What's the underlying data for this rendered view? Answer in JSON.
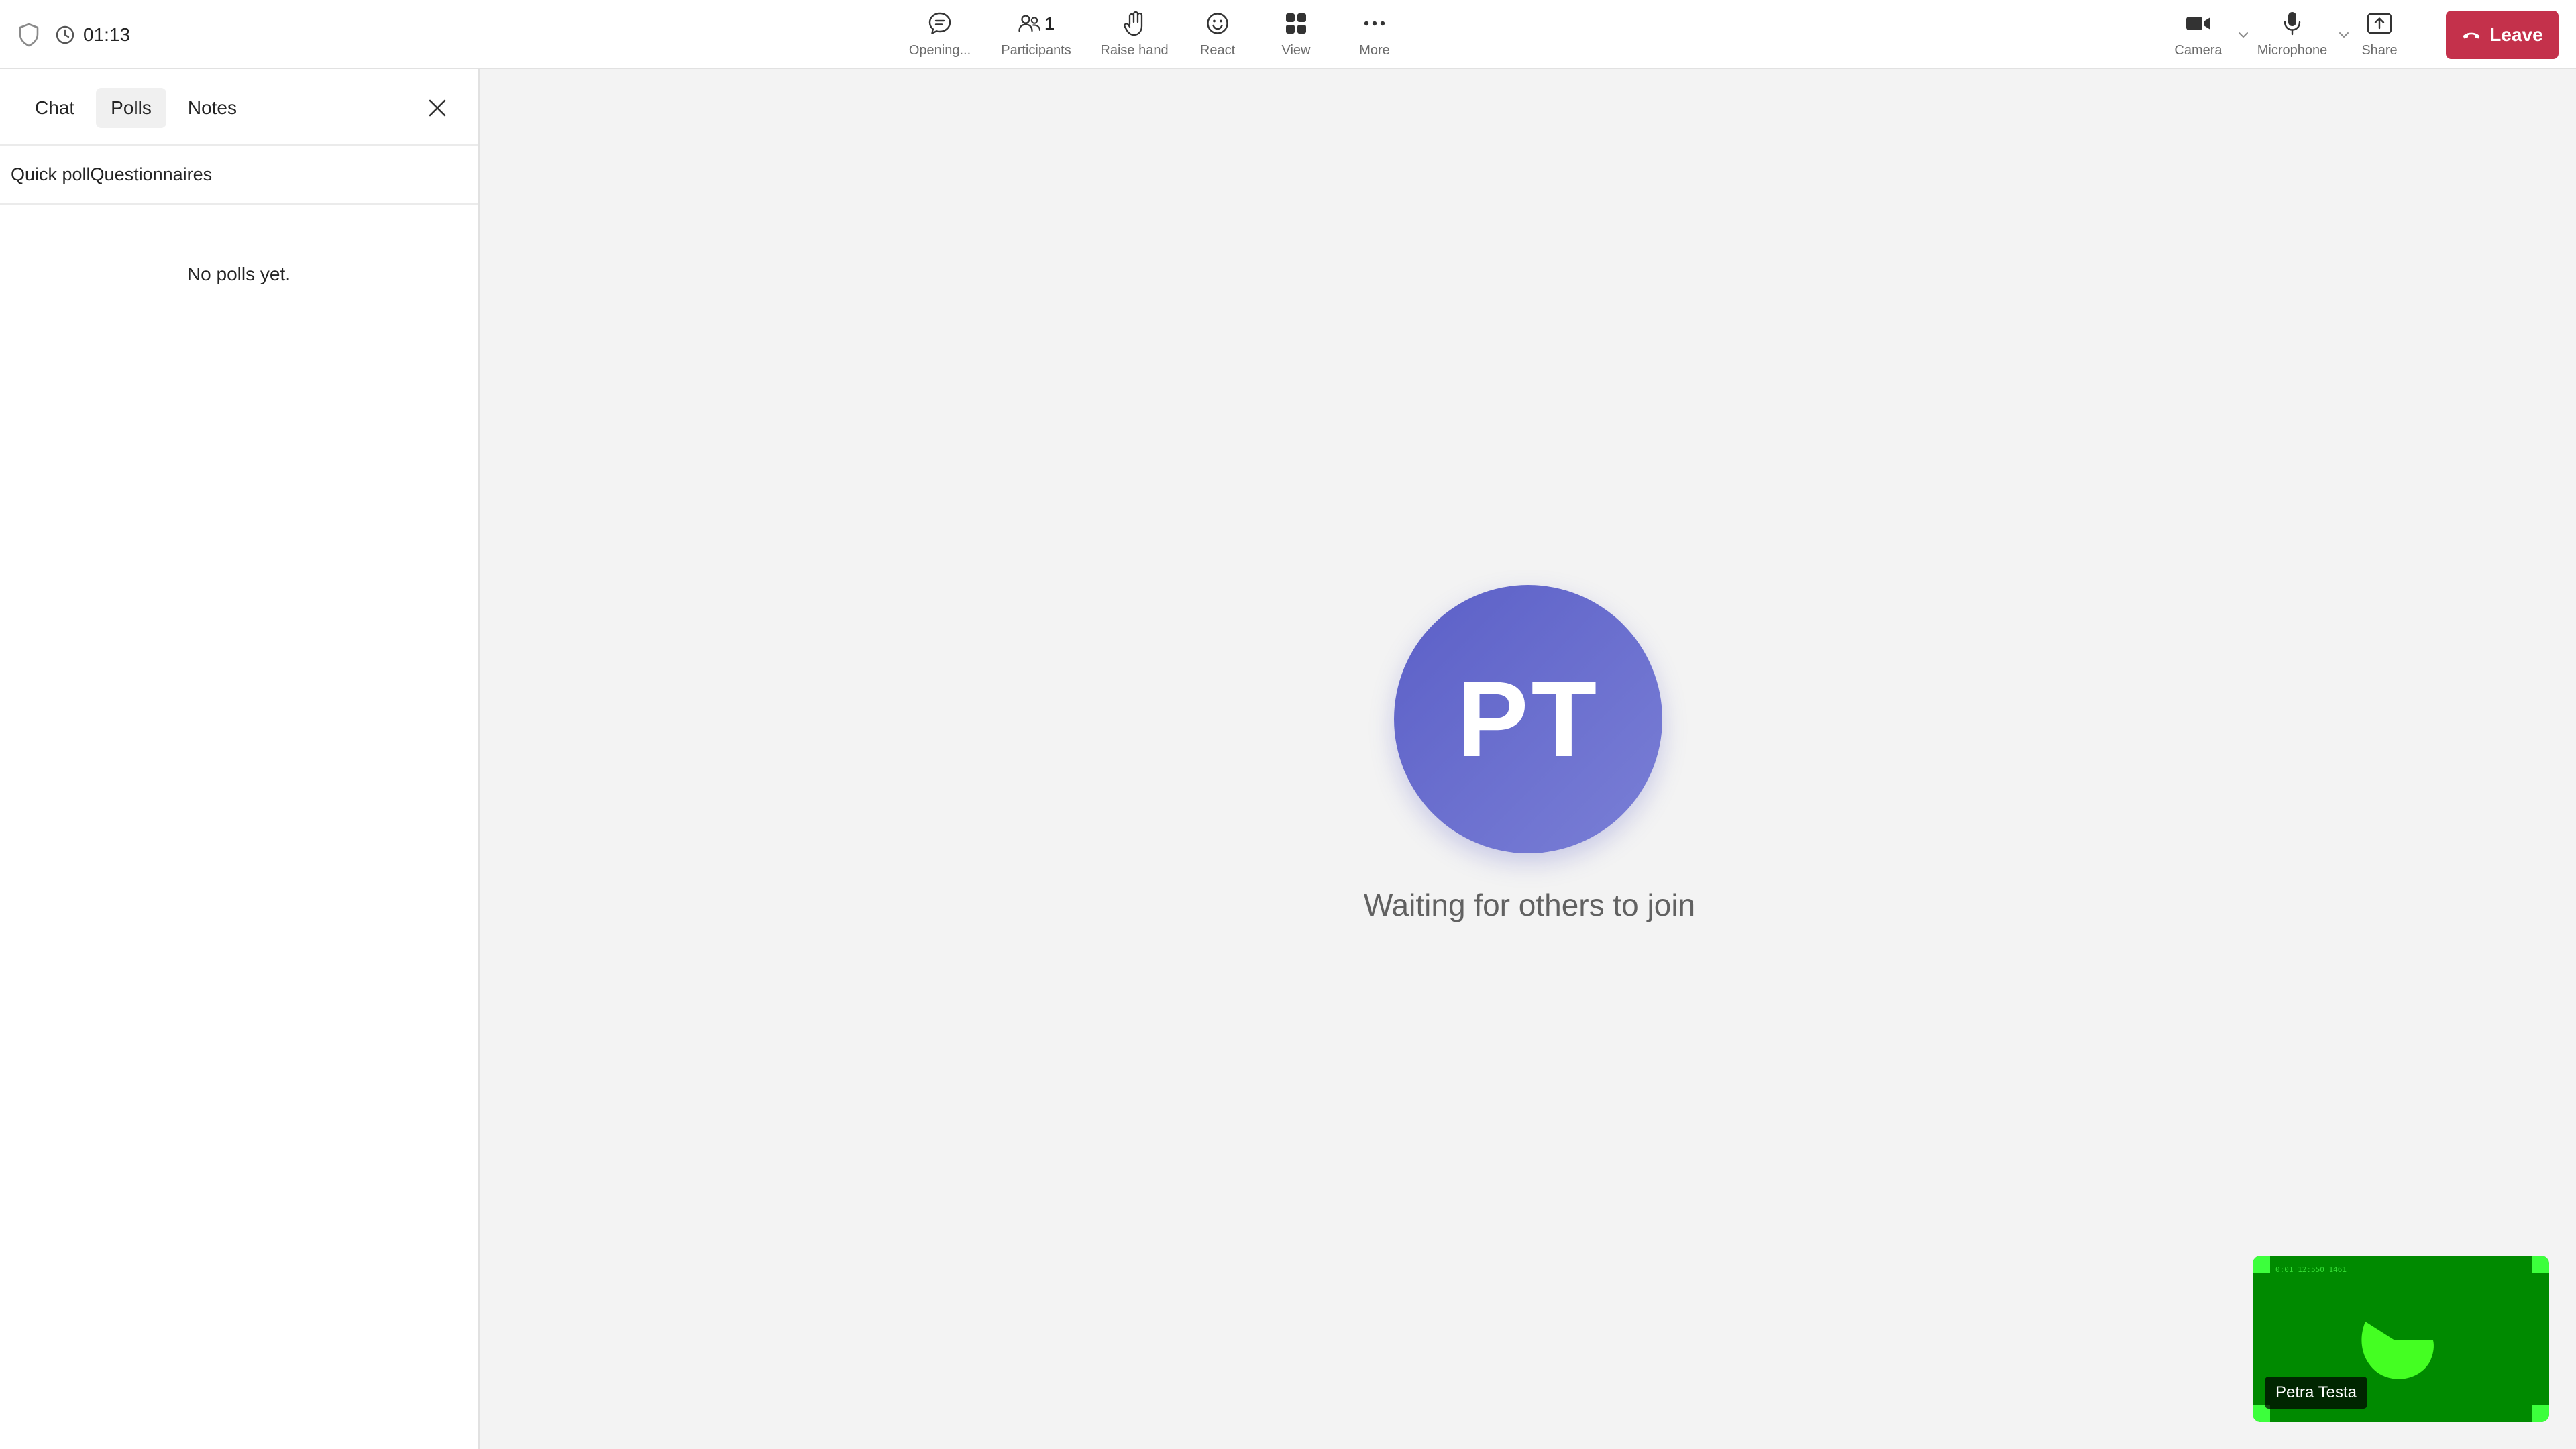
{
  "header": {
    "timer": "01:13",
    "center_buttons": [
      {
        "label": "Opening...",
        "icon": "chat-icon"
      },
      {
        "label": "Participants",
        "icon": "people-icon",
        "count": "1"
      },
      {
        "label": "Raise hand",
        "icon": "hand-icon"
      },
      {
        "label": "React",
        "icon": "smiley-icon"
      },
      {
        "label": "View",
        "icon": "grid-icon"
      },
      {
        "label": "More",
        "icon": "more-dots-icon"
      }
    ],
    "right_buttons": [
      {
        "label": "Camera",
        "icon": "camera-icon"
      },
      {
        "label": "Microphone",
        "icon": "microphone-icon"
      },
      {
        "label": "Share",
        "icon": "share-icon"
      }
    ],
    "leave_label": "Leave"
  },
  "sidebar": {
    "tabs": [
      {
        "label": "Chat",
        "active": false
      },
      {
        "label": "Polls",
        "active": true
      },
      {
        "label": "Notes",
        "active": false
      }
    ],
    "poll_options": [
      "Quick poll",
      "Questionnaires"
    ],
    "empty_message": "No polls yet."
  },
  "stage": {
    "avatar_initials": "PT",
    "waiting_text": "Waiting for others to join"
  },
  "self_view": {
    "name": "Petra Testa",
    "stamp": "0:01 12:550 1461"
  },
  "colors": {
    "accent": "#5b5fc7",
    "leave": "#c4314b",
    "self_video_bg": "#008a00",
    "self_video_highlight": "#3cff3c"
  }
}
